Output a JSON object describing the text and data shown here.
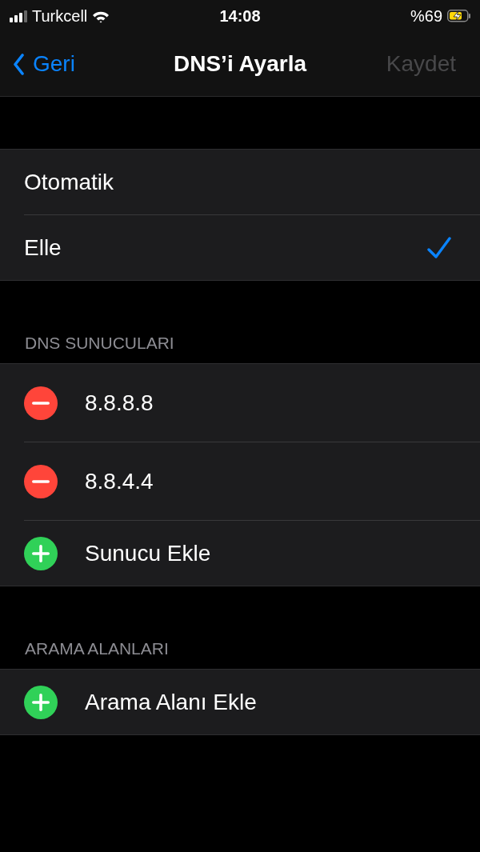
{
  "status_bar": {
    "carrier": "Turkcell",
    "time": "14:08",
    "battery": "%69"
  },
  "nav": {
    "back": "Geri",
    "title": "DNS’i Ayarla",
    "save": {
      "label": "Kaydet",
      "disabled": true
    }
  },
  "modes": [
    {
      "label": "Otomatik",
      "selected": false
    },
    {
      "label": "Elle",
      "selected": true
    }
  ],
  "sections": [
    {
      "header": "DNS SUNUCULARI",
      "rows": [
        {
          "kind": "remove",
          "label": "8.8.8.8"
        },
        {
          "kind": "remove",
          "label": "8.8.4.4"
        },
        {
          "kind": "add",
          "label": "Sunucu Ekle"
        }
      ]
    },
    {
      "header": "ARAMA ALANLARI",
      "rows": [
        {
          "kind": "add",
          "label": "Arama Alanı Ekle"
        }
      ]
    }
  ]
}
